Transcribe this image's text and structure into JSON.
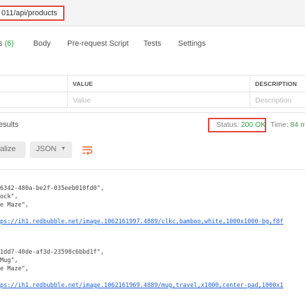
{
  "url": {
    "text": "011/api/products"
  },
  "request_tabs": [
    {
      "label": "s ",
      "count": "(6)"
    },
    {
      "label": "Body"
    },
    {
      "label": "Pre-request Script"
    },
    {
      "label": "Tests"
    },
    {
      "label": "Settings"
    }
  ],
  "params": {
    "headers": {
      "value": "VALUE",
      "description": "DESCRIPTION"
    },
    "placeholders": {
      "value": "Value",
      "description": "Description"
    }
  },
  "response": {
    "tab_label": "esults",
    "status_label": "Status:",
    "status_value": "200 OK",
    "time_label": "Time:",
    "time_value": "84 m"
  },
  "toolbar": {
    "beautify_label": "alize",
    "format_label": "JSON",
    "format_caret": "▼"
  },
  "code_lines": [
    {
      "text": "6342-480a-be2f-035eeb010fd0\",",
      "link": false
    },
    {
      "text": "ock\",",
      "link": false
    },
    {
      "text": "e Maze\",",
      "link": false
    },
    {
      "text": "ps://ih1.redbubble.net/image.1062161997.4889/clkc,bamboo,white,1000x1000-bg,f8f",
      "link": true
    },
    {
      "text": "1dd7-40de-af3d-23598c6bbd1f\",",
      "link": false
    },
    {
      "text": "Mug\",",
      "link": false
    },
    {
      "text": "e Maze\",",
      "link": false
    },
    {
      "text": "ps://ih1.redbubble.net/image.1062161969.4889/mug,travel,x1000,center-pad,1000x1",
      "link": true
    }
  ],
  "colors": {
    "accent_red": "#e0463e",
    "status_green": "#30a040",
    "link_blue": "#1d5fd6",
    "wrap_orange": "#f26b3a"
  }
}
